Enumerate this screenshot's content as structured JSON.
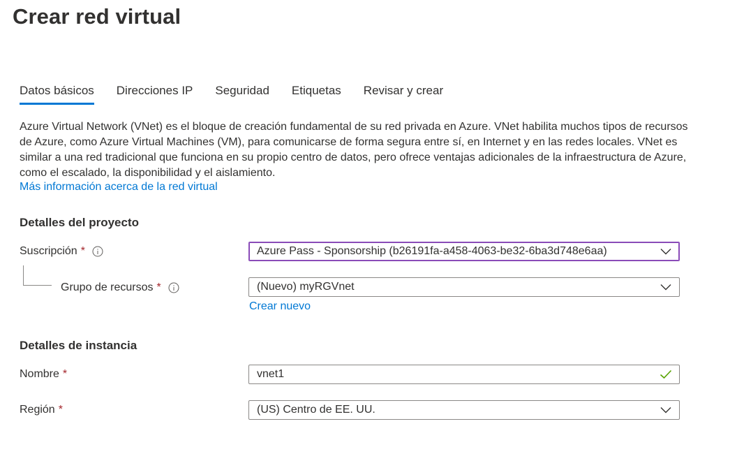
{
  "page": {
    "title": "Crear red virtual"
  },
  "tabs": [
    {
      "label": "Datos básicos",
      "active": true
    },
    {
      "label": "Direcciones IP",
      "active": false
    },
    {
      "label": "Seguridad",
      "active": false
    },
    {
      "label": "Etiquetas",
      "active": false
    },
    {
      "label": "Revisar y crear",
      "active": false
    }
  ],
  "intro": {
    "description": "Azure Virtual Network (VNet) es el bloque de creación fundamental de su red privada en Azure. VNet habilita muchos tipos de recursos de Azure, como Azure Virtual Machines (VM), para comunicarse de forma segura entre sí, en Internet y en las redes locales. VNet es similar a una red tradicional que funciona en su propio centro de datos, pero ofrece ventajas adicionales de la infraestructura de Azure, como el escalado, la disponibilidad y el aislamiento.",
    "learn_more": "Más información acerca de la red virtual"
  },
  "project": {
    "heading": "Detalles del proyecto",
    "subscription": {
      "label": "Suscripción",
      "required": "*",
      "value": "Azure Pass - Sponsorship (b26191fa-a458-4063-be32-6ba3d748e6aa)"
    },
    "resource_group": {
      "label": "Grupo de recursos",
      "required": "*",
      "value": "(Nuevo) myRGVnet",
      "create_new": "Crear nuevo"
    }
  },
  "instance": {
    "heading": "Detalles de instancia",
    "name": {
      "label": "Nombre",
      "required": "*",
      "value": "vnet1"
    },
    "region": {
      "label": "Región",
      "required": "*",
      "value": "(US) Centro de EE. UU."
    }
  },
  "colors": {
    "link": "#0078d4",
    "required": "#a4262c",
    "valid": "#57a300",
    "focus_border": "#8a4bb8"
  },
  "icons": {
    "info": "info-icon",
    "dropdown": "chevron-down-icon",
    "valid": "checkmark-icon"
  }
}
